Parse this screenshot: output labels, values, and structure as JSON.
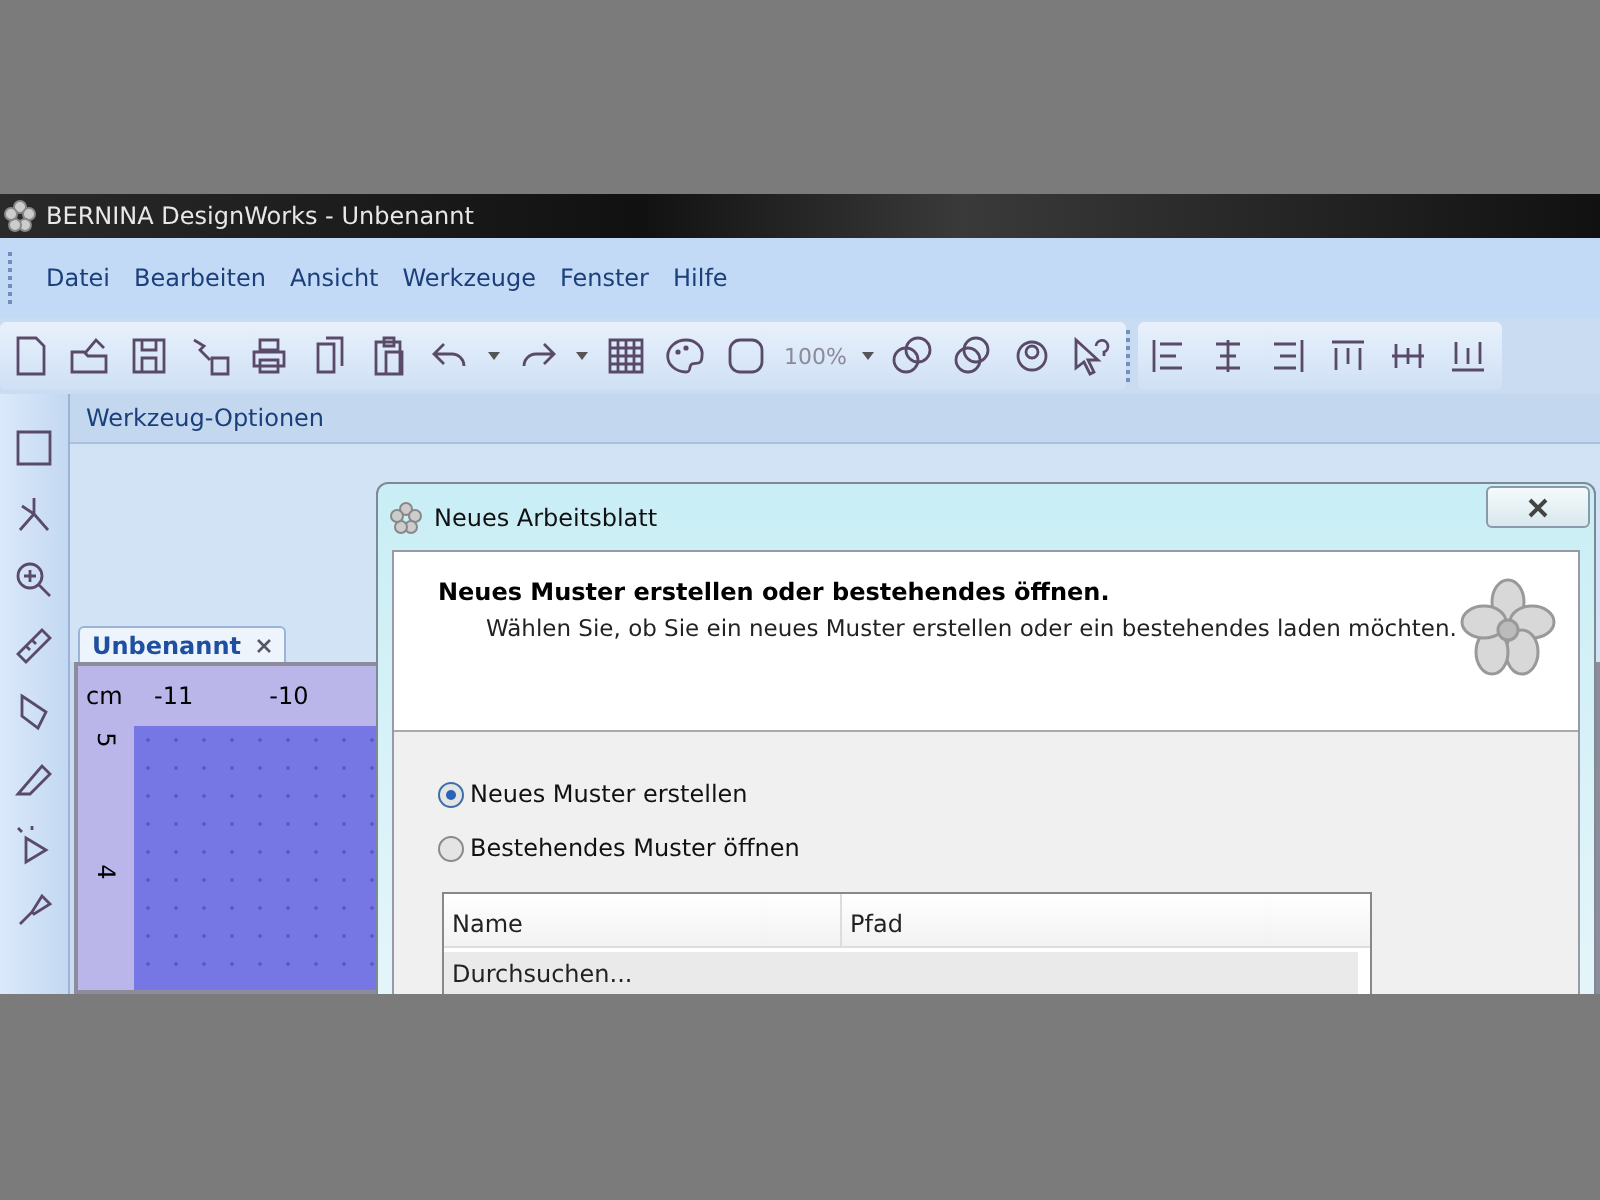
{
  "app_window": {
    "title": "BERNINA DesignWorks - Unbenannt"
  },
  "menu": [
    {
      "label": "Datei"
    },
    {
      "label": "Bearbeiten"
    },
    {
      "label": "Ansicht"
    },
    {
      "label": "Werkzeuge"
    },
    {
      "label": "Fenster"
    },
    {
      "label": "Hilfe"
    }
  ],
  "toolbar": {
    "zoom": "100%"
  },
  "tool_options": {
    "title": "Werkzeug-Optionen"
  },
  "document_tabs": [
    {
      "label": "Unbenannt",
      "selected": true
    }
  ],
  "ruler": {
    "unit": "cm",
    "x_labels": [
      "-11",
      "-10"
    ],
    "y_labels": [
      "5",
      "4"
    ]
  },
  "dialog": {
    "title": "Neues Arbeitsblatt",
    "heading": "Neues Muster erstellen oder bestehendes öffnen.",
    "subtitle": "Wählen Sie, ob Sie ein neues Muster erstellen oder ein bestehendes laden möchten.",
    "options": [
      {
        "label": "Neues Muster erstellen",
        "selected": true
      },
      {
        "label": "Bestehendes Muster öffnen",
        "selected": false
      }
    ],
    "table": {
      "columns": [
        "Name",
        "Pfad"
      ],
      "rows": [
        {
          "name": "Durchsuchen...",
          "selected": true
        }
      ]
    }
  }
}
